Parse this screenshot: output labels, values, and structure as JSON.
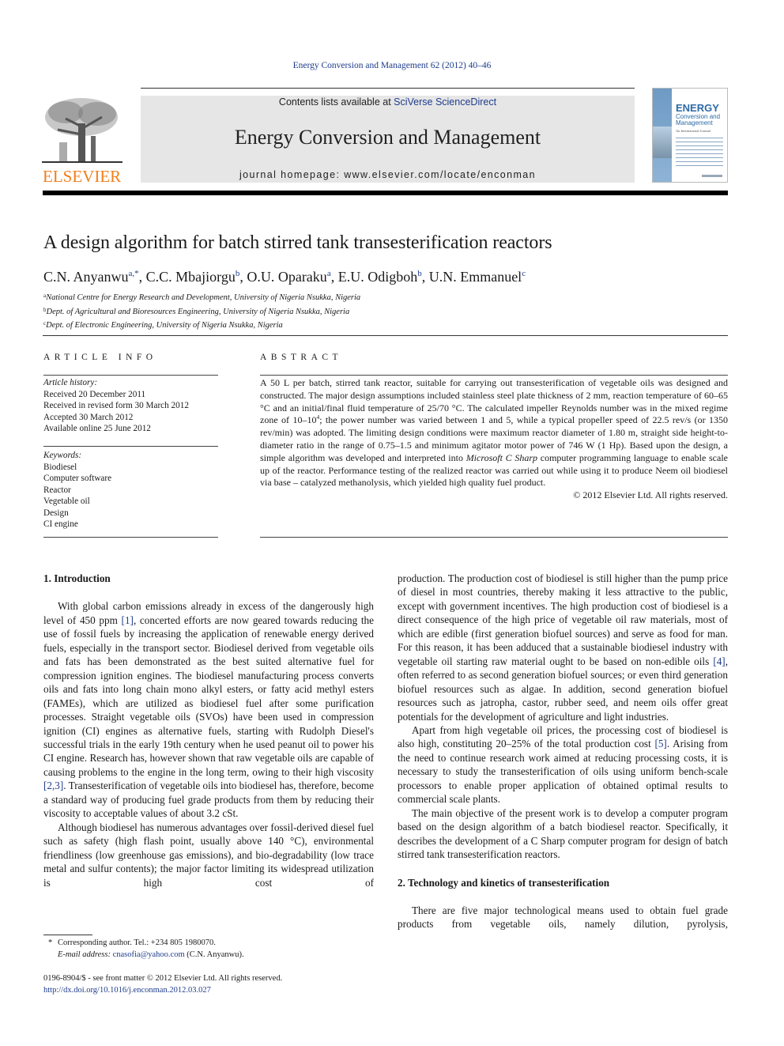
{
  "running_head": "Energy Conversion and Management 62 (2012) 40–46",
  "masthead": {
    "contents_prefix": "Contents lists available at ",
    "contents_link": "SciVerse ScienceDirect",
    "journal_title": "Energy Conversion and Management",
    "homepage": "journal homepage: www.elsevier.com/locate/enconman"
  },
  "publisher_logo": "ELSEVIER",
  "cover": {
    "title": "ENERGY",
    "subtitle": "Conversion and Management",
    "tagline": "An International Journal"
  },
  "article": {
    "title": "A design algorithm for batch stirred tank transesterification reactors",
    "authors": [
      {
        "name": "C.N. Anyanwu",
        "sup": "a,*",
        "sep": ", "
      },
      {
        "name": "C.C. Mbajiorgu",
        "sup": "b",
        "sep": ", "
      },
      {
        "name": "O.U. Oparaku",
        "sup": "a",
        "sep": ", "
      },
      {
        "name": "E.U. Odigboh",
        "sup": "b",
        "sep": ", "
      },
      {
        "name": "U.N. Emmanuel",
        "sup": "c",
        "sep": ""
      }
    ],
    "affiliations": [
      {
        "sup": "a",
        "text": "National Centre for Energy Research and Development, University of Nigeria Nsukka, Nigeria"
      },
      {
        "sup": "b",
        "text": "Dept. of Agricultural and Bioresources Engineering, University of Nigeria Nsukka, Nigeria"
      },
      {
        "sup": "c",
        "text": "Dept. of Electronic Engineering, University of Nigeria Nsukka, Nigeria"
      }
    ]
  },
  "article_info": {
    "heading": "ARTICLE INFO",
    "history_label": "Article history:",
    "history": [
      "Received 20 December 2011",
      "Received in revised form 30 March 2012",
      "Accepted 30 March 2012",
      "Available online 25 June 2012"
    ],
    "keywords_label": "Keywords:",
    "keywords": [
      "Biodiesel",
      "Computer software",
      "Reactor",
      "Vegetable oil",
      "Design",
      "CI engine"
    ]
  },
  "abstract": {
    "heading": "ABSTRACT",
    "part1": "A 50 L per batch, stirred tank reactor, suitable for carrying out transesterification of vegetable oils was designed and constructed. The major design assumptions included stainless steel plate thickness of 2 mm, reaction temperature of 60–65 °C and an initial/final fluid temperature of 25/70 °C. The calculated impeller Reynolds number was in the mixed regime zone of 10–10",
    "sup": "4",
    "part2": "; the power number was varied between 1 and 5, while a typical propeller speed of 22.5 rev/s (or 1350 rev/min) was adopted. The limiting design conditions were maximum reactor diameter of 1.80 m, straight side height-to-diameter ratio in the range of 0.75–1.5 and minimum agitator motor power of 746 W (1 Hp). Based upon the design, a simple algorithm was developed and interpreted into ",
    "italic": "Microsoft C Sharp",
    "part3": " computer programming language to enable scale up of the reactor. Performance testing of the realized reactor was carried out while using it to produce Neem oil biodiesel via base – catalyzed methanolysis, which yielded high quality fuel product.",
    "copyright": "© 2012 Elsevier Ltd. All rights reserved."
  },
  "body": {
    "section1_heading": "1. Introduction",
    "p1_a": "With global carbon emissions already in excess of the dangerously high level of 450 ppm ",
    "p1_ref1": "[1]",
    "p1_b": ", concerted efforts are now geared towards reducing the use of fossil fuels by increasing the application of renewable energy derived fuels, especially in the transport sector. Biodiesel derived from vegetable oils and fats has been demonstrated as the best suited alternative fuel for compression ignition engines. The biodiesel manufacturing process converts oils and fats into long chain mono alkyl esters, or fatty acid methyl esters (FAMEs), which are utilized as biodiesel fuel after some purification processes. Straight vegetable oils (SVOs) have been used in compression ignition (CI) engines as alternative fuels, starting with Rudolph Diesel's successful trials in the early 19th century when he used peanut oil to power his CI engine. Research has, however shown that raw vegetable oils are capable of causing problems to the engine in the long term, owing to their high viscosity ",
    "p1_ref2": "[2,3]",
    "p1_c": ". Transesterification of vegetable oils into biodiesel has, therefore, become a standard way of producing fuel grade products from them by reducing their viscosity to acceptable values of about 3.2 cSt.",
    "p2": "Although biodiesel has numerous advantages over fossil-derived diesel fuel such as safety (high flash point, usually above 140 °C), environmental friendliness (low greenhouse gas emissions), and bio-degradability (low trace metal and sulfur contents); the major factor limiting its widespread utilization is high cost of",
    "p2_cont_a": "production. The production cost of biodiesel is still higher than the pump price of diesel in most countries, thereby making it less attractive to the public, except with government incentives. The high production cost of biodiesel is a direct consequence of the high price of vegetable oil raw materials, most of which are edible (first generation biofuel sources) and serve as food for man. For this reason, it has been adduced that a sustainable biodiesel industry with vegetable oil starting raw material ought to be based on non-edible oils ",
    "p2_ref": "[4]",
    "p2_cont_b": ", often referred to as second generation biofuel sources; or even third generation biofuel resources such as algae. In addition, second generation biofuel resources such as jatropha, castor, rubber seed, and neem oils offer great potentials for the development of agriculture and light industries.",
    "p3_a": "Apart from high vegetable oil prices, the processing cost of biodiesel is also high, constituting 20–25% of the total production cost ",
    "p3_ref": "[5]",
    "p3_b": ". Arising from the need to continue research work aimed at reducing processing costs, it is necessary to study the transesterification of oils using uniform bench-scale processors to enable proper application of obtained optimal results to commercial scale plants.",
    "p4": "The main objective of the present work is to develop a computer program based on the design algorithm of a batch biodiesel reactor. Specifically, it describes the development of a C Sharp computer program for design of batch stirred tank transesterification reactors.",
    "section2_heading": "2. Technology and kinetics of transesterification",
    "p5": "There are five major technological means used to obtain fuel grade products from vegetable oils, namely dilution, pyrolysis,"
  },
  "footnote": {
    "star": "*",
    "corresponding": "Corresponding author. Tel.: +234 805 1980070.",
    "email_label": "E-mail address: ",
    "email": "cnasofia@yahoo.com",
    "email_suffix": " (C.N. Anyanwu)."
  },
  "footer": {
    "issn_line": "0196-8904/$ - see front matter © 2012 Elsevier Ltd. All rights reserved.",
    "doi": "http://dx.doi.org/10.1016/j.enconman.2012.03.027"
  }
}
